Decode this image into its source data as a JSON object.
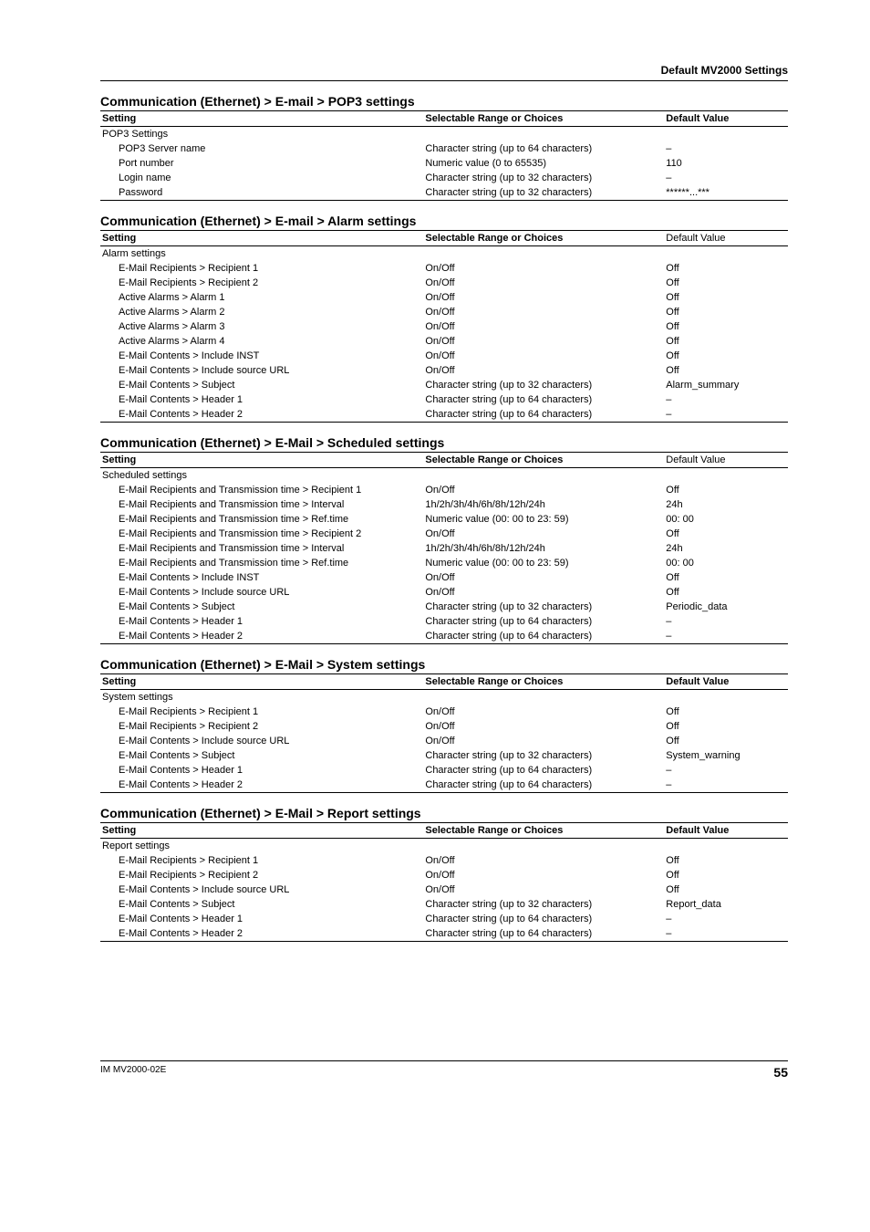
{
  "page_header": "Default MV2000 Settings",
  "col_setting": "Setting",
  "col_range": "Selectable Range or Choices",
  "col_default": "Default Value",
  "sections": [
    {
      "title": "Communication (Ethernet) > E-mail > POP3 settings",
      "default_header_bold": true,
      "group": "POP3 Settings",
      "rows": [
        {
          "s": "POP3 Server name",
          "r": "Character string (up to 64 characters)",
          "d": "–"
        },
        {
          "s": "Port number",
          "r": "Numeric value (0 to 65535)",
          "d": "110"
        },
        {
          "s": "Login name",
          "r": "Character string (up to 32 characters)",
          "d": "–"
        },
        {
          "s": "Password",
          "r": "Character string (up to 32 characters)",
          "d": "******...***"
        }
      ]
    },
    {
      "title": "Communication (Ethernet) > E-mail > Alarm settings",
      "default_header_bold": false,
      "group": "Alarm settings",
      "rows": [
        {
          "s": "E-Mail Recipients > Recipient 1",
          "r": "On/Off",
          "d": "Off"
        },
        {
          "s": "E-Mail Recipients > Recipient 2",
          "r": "On/Off",
          "d": "Off"
        },
        {
          "s": "Active Alarms > Alarm 1",
          "r": "On/Off",
          "d": "Off"
        },
        {
          "s": "Active Alarms > Alarm 2",
          "r": "On/Off",
          "d": "Off"
        },
        {
          "s": "Active Alarms > Alarm 3",
          "r": "On/Off",
          "d": "Off"
        },
        {
          "s": "Active Alarms > Alarm 4",
          "r": "On/Off",
          "d": "Off"
        },
        {
          "s": "E-Mail Contents > Include INST",
          "r": "On/Off",
          "d": "Off"
        },
        {
          "s": "E-Mail Contents > Include source URL",
          "r": "On/Off",
          "d": "Off"
        },
        {
          "s": "E-Mail Contents > Subject",
          "r": "Character string (up to 32 characters)",
          "d": "Alarm_summary"
        },
        {
          "s": "E-Mail Contents > Header 1",
          "r": "Character string (up to 64 characters)",
          "d": "–"
        },
        {
          "s": "E-Mail Contents > Header 2",
          "r": "Character string (up to 64 characters)",
          "d": "–"
        }
      ]
    },
    {
      "title": "Communication (Ethernet) > E-Mail > Scheduled settings",
      "default_header_bold": false,
      "group": "Scheduled settings",
      "rows": [
        {
          "s": "E-Mail Recipients and Transmission time > Recipient 1",
          "r": "On/Off",
          "d": "Off"
        },
        {
          "s": "E-Mail Recipients and Transmission time > Interval",
          "r": "1h/2h/3h/4h/6h/8h/12h/24h",
          "d": "24h"
        },
        {
          "s": "E-Mail Recipients and Transmission time > Ref.time",
          "r": "Numeric value (00: 00 to 23: 59)",
          "d": "00: 00"
        },
        {
          "s": "E-Mail Recipients and Transmission time > Recipient 2",
          "r": "On/Off",
          "d": "Off"
        },
        {
          "s": "E-Mail Recipients and Transmission time > Interval",
          "r": "1h/2h/3h/4h/6h/8h/12h/24h",
          "d": "24h"
        },
        {
          "s": "E-Mail Recipients and Transmission time > Ref.time",
          "r": "Numeric value (00: 00 to 23: 59)",
          "d": "00: 00"
        },
        {
          "s": "E-Mail Contents > Include INST",
          "r": "On/Off",
          "d": "Off"
        },
        {
          "s": "E-Mail Contents > Include source URL",
          "r": "On/Off",
          "d": "Off"
        },
        {
          "s": "E-Mail Contents > Subject",
          "r": "Character string (up to 32 characters)",
          "d": "Periodic_data"
        },
        {
          "s": "E-Mail Contents > Header 1",
          "r": "Character string (up to 64 characters)",
          "d": "–"
        },
        {
          "s": "E-Mail Contents > Header 2",
          "r": "Character string (up to 64 characters)",
          "d": "–"
        }
      ]
    },
    {
      "title": "Communication (Ethernet) > E-Mail > System settings",
      "default_header_bold": true,
      "group": "System settings",
      "rows": [
        {
          "s": "E-Mail Recipients > Recipient 1",
          "r": "On/Off",
          "d": "Off"
        },
        {
          "s": "E-Mail Recipients > Recipient 2",
          "r": "On/Off",
          "d": "Off"
        },
        {
          "s": "E-Mail Contents > Include source URL",
          "r": "On/Off",
          "d": "Off"
        },
        {
          "s": "E-Mail Contents > Subject",
          "r": "Character string (up to 32 characters)",
          "d": "System_warning"
        },
        {
          "s": "E-Mail Contents > Header 1",
          "r": "Character string (up to 64 characters)",
          "d": "–"
        },
        {
          "s": "E-Mail Contents > Header 2",
          "r": "Character string (up to 64 characters)",
          "d": "–"
        }
      ]
    },
    {
      "title": "Communication (Ethernet) > E-Mail > Report settings",
      "default_header_bold": true,
      "group": "Report settings",
      "rows": [
        {
          "s": "E-Mail Recipients > Recipient 1",
          "r": "On/Off",
          "d": "Off"
        },
        {
          "s": "E-Mail Recipients > Recipient 2",
          "r": "On/Off",
          "d": "Off"
        },
        {
          "s": "E-Mail Contents > Include source URL",
          "r": "On/Off",
          "d": "Off"
        },
        {
          "s": "E-Mail Contents > Subject",
          "r": "Character string (up to 32 characters)",
          "d": "Report_data"
        },
        {
          "s": "E-Mail Contents > Header 1",
          "r": "Character string (up to 64 characters)",
          "d": "–"
        },
        {
          "s": "E-Mail Contents > Header 2",
          "r": "Character string (up to 64 characters)",
          "d": "–"
        }
      ]
    }
  ],
  "footer_left": "IM MV2000-02E",
  "footer_page": "55"
}
